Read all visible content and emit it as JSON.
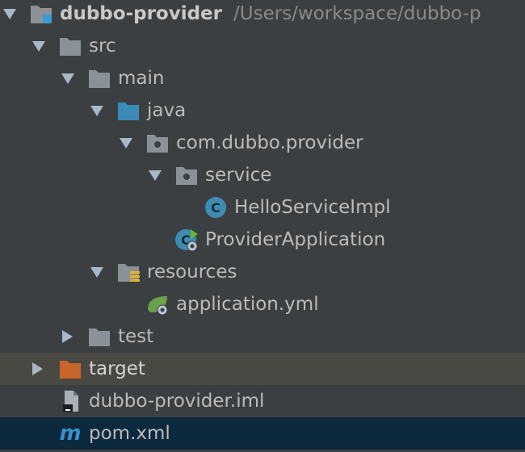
{
  "tree": {
    "root": {
      "name": "dubbo-provider",
      "path": "/Users/workspace/dubbo-p",
      "icon": "module-folder-icon"
    },
    "src": {
      "name": "src",
      "icon": "folder-icon"
    },
    "main": {
      "name": "main",
      "icon": "folder-icon"
    },
    "java": {
      "name": "java",
      "icon": "source-root-folder-icon"
    },
    "package": {
      "name": "com.dubbo.provider",
      "icon": "package-icon"
    },
    "service": {
      "name": "service",
      "icon": "package-icon"
    },
    "hello": {
      "name": "HelloServiceImpl",
      "icon": "java-class-icon"
    },
    "provider_app": {
      "name": "ProviderApplication",
      "icon": "spring-boot-class-icon"
    },
    "resources": {
      "name": "resources",
      "icon": "resources-folder-icon"
    },
    "app_yml": {
      "name": "application.yml",
      "icon": "spring-config-icon"
    },
    "test": {
      "name": "test",
      "icon": "folder-icon"
    },
    "target": {
      "name": "target",
      "icon": "excluded-folder-icon"
    },
    "iml": {
      "name": "dubbo-provider.iml",
      "icon": "iml-file-icon"
    },
    "pom": {
      "name": "pom.xml",
      "icon": "maven-icon",
      "icon_glyph": "m"
    }
  },
  "colors": {
    "background": "#3c3f41",
    "excluded_row": "#4a4843",
    "selected_row": "#0d293e",
    "folder": "#8b9196",
    "source_folder": "#3b8bb6",
    "excluded_folder": "#c7652b",
    "java_class": "#3d8cb5",
    "spring_green": "#6aa14a",
    "maven": "#3b8ec9"
  }
}
